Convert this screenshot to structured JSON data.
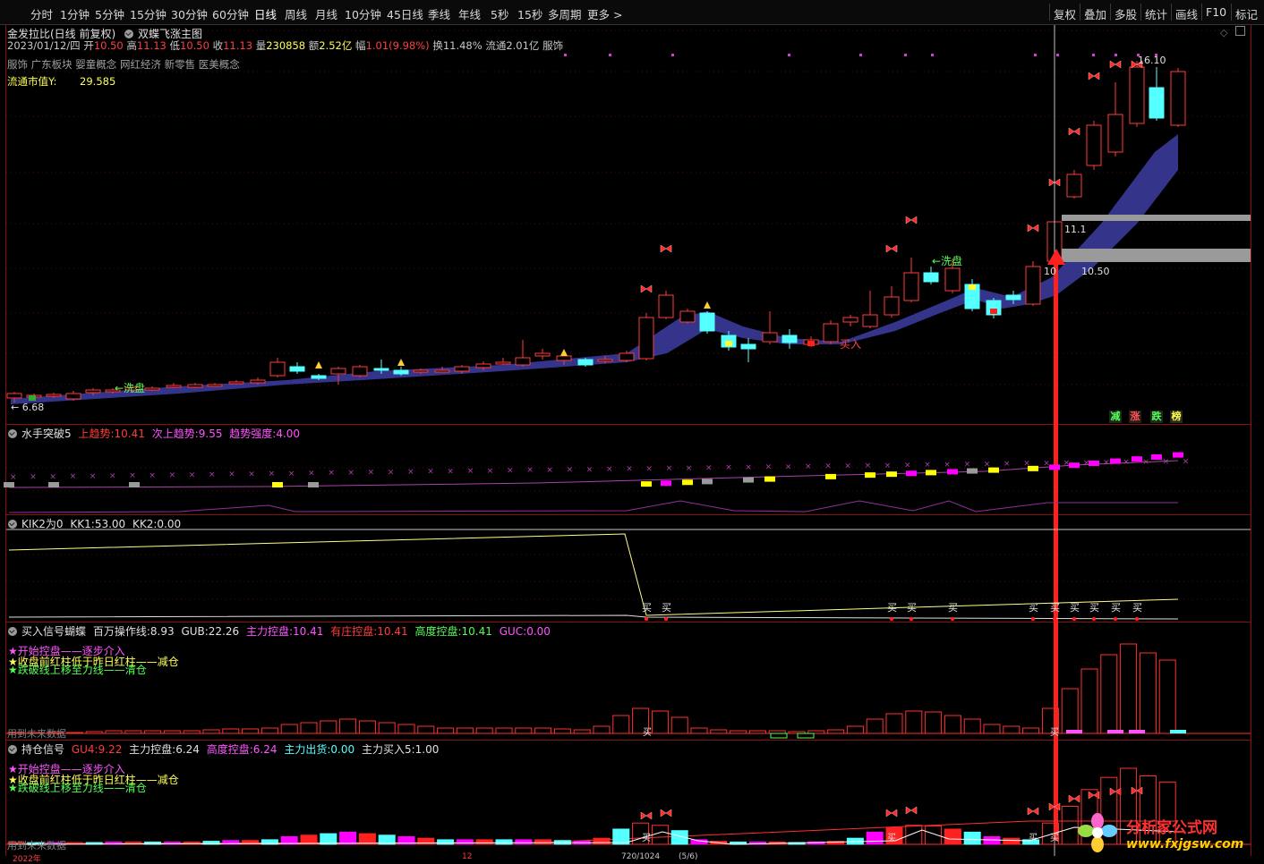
{
  "toolbar": {
    "periods": [
      "分时",
      "1分钟",
      "5分钟",
      "15分钟",
      "30分钟",
      "60分钟",
      "日线",
      "周线",
      "月线",
      "10分钟",
      "45日线",
      "季线",
      "年线",
      "5秒",
      "15秒",
      "多周期",
      "更多 >"
    ],
    "active_period": "日线",
    "tools": [
      "复权",
      "叠加",
      "多股",
      "统计",
      "画线",
      "F10",
      "标记"
    ]
  },
  "stock": {
    "name_line": "金发拉比(日线 前复权)",
    "indicator_name": "双蝶飞涨主图",
    "date": "2023/01/12/四",
    "open_label": "开",
    "open": "10.50",
    "high_label": "高",
    "high": "11.13",
    "low_label": "低",
    "low": "10.50",
    "close_label": "收",
    "close": "11.13",
    "volume_label": "量",
    "volume": "230858",
    "amount_label": "额",
    "amount": "2.52亿",
    "change_label": "幅",
    "change": "1.01(9.98%)",
    "turnover_label": "换",
    "turnover": "11.48%",
    "float_label": "流通",
    "float": "2.01亿",
    "industry": "服饰",
    "concepts": "服饰 广东板块 婴童概念 网红经济 新零售 医美概念",
    "mktcap_label": "流通市值Y:",
    "mktcap_value": "29.585"
  },
  "main_chart": {
    "price_high_label": "16.10",
    "price_low_label": "← 6.68",
    "wash_label_1": "←洗盘",
    "wash_label_2": "←洗盘",
    "buy_label": "买入",
    "level_label_1": "11.1",
    "level_label_2": "10",
    "level_label_3": "10.50",
    "tags": [
      "减",
      "涨",
      "跌",
      "榜"
    ]
  },
  "pane1": {
    "name": "水手突破5",
    "items": [
      {
        "label": "上趋势:",
        "value": "10.41"
      },
      {
        "label": "次上趋势:",
        "value": "9.55"
      },
      {
        "label": "趋势强度:",
        "value": "4.00"
      }
    ]
  },
  "pane2": {
    "name": "KIK2为0",
    "items": [
      {
        "label": "KK1:",
        "value": "53.00"
      },
      {
        "label": "KK2:",
        "value": "0.00"
      }
    ],
    "buy_mark": "买"
  },
  "pane3": {
    "name": "买入信号蝴蝶",
    "items": [
      {
        "label": "百万操作线:",
        "value": "8.93"
      },
      {
        "label": "GUB:",
        "value": "22.26"
      },
      {
        "label": "主力控盘:",
        "value": "10.41"
      },
      {
        "label": "有庄控盘:",
        "value": "10.41"
      },
      {
        "label": "高度控盘:",
        "value": "10.41"
      },
      {
        "label": "GUC:",
        "value": "0.00"
      }
    ],
    "legend_1": "★开始控盘——逐步介入",
    "legend_2": "★收盘前红柱低于昨日红柱——减仓",
    "legend_3": "★跌破线上移至力线——清仓",
    "bottom_note": "用到未来数据"
  },
  "pane4": {
    "name": "持仓信号",
    "items": [
      {
        "label": "GU4:",
        "value": "9.22"
      },
      {
        "label": "主力控盘:",
        "value": "6.24"
      },
      {
        "label": "高度控盘:",
        "value": "6.24"
      },
      {
        "label": "主力出货:",
        "value": "0.00"
      },
      {
        "label": "主力买入5:",
        "value": "1.00"
      }
    ],
    "legend_1": "★开始控盘——逐步介入",
    "legend_2": "★收盘前红柱低于昨日红柱——减仓",
    "legend_3": "★跌破线上移至力线——清仓",
    "bottom_note": "用到未来数据"
  },
  "watermark": {
    "title": "分析家公式网",
    "url": "www.fxjgsw.com"
  },
  "bottom_axis": {
    "year": "2022年",
    "month": "12",
    "range": "720/1024",
    "pages": "(5/6)"
  },
  "colors": {
    "up": "#ff3c3c",
    "down": "#54ffff",
    "cloud": "#3a3a9a",
    "pane_border": "#8a1010",
    "yellow": "#ffff00",
    "magenta": "#ff00ff"
  }
}
